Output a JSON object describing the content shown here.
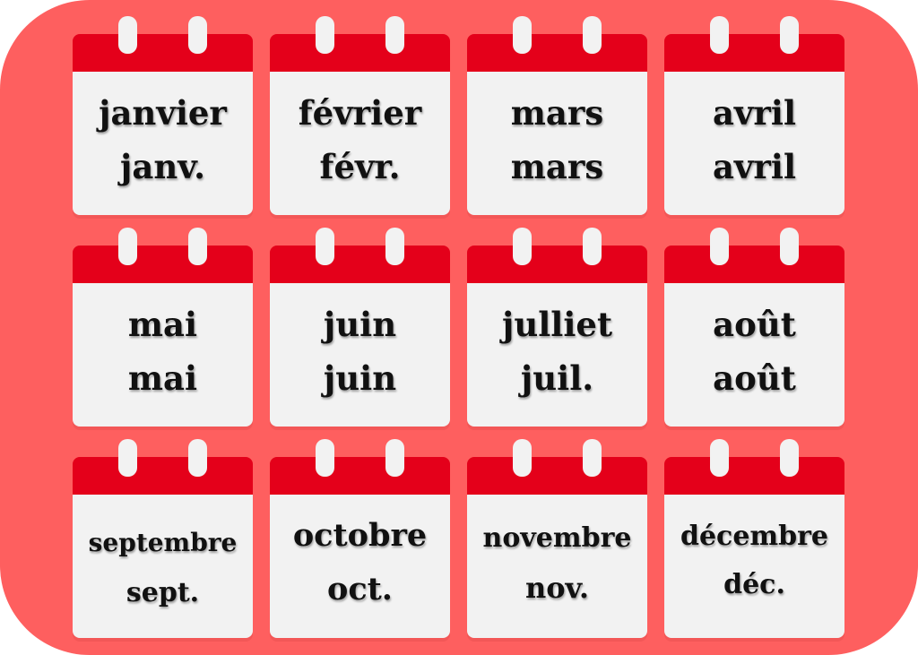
{
  "months": [
    {
      "name": "janvier",
      "abbr": "janv."
    },
    {
      "name": "février",
      "abbr": "févr."
    },
    {
      "name": "mars",
      "abbr": "mars"
    },
    {
      "name": "avril",
      "abbr": "avril"
    },
    {
      "name": "mai",
      "abbr": "mai"
    },
    {
      "name": "juin",
      "abbr": "juin"
    },
    {
      "name": "julliet",
      "abbr": "juil."
    },
    {
      "name": "août",
      "abbr": "août"
    },
    {
      "name": "septembre",
      "abbr": "sept."
    },
    {
      "name": "octobre",
      "abbr": "oct."
    },
    {
      "name": "novembre",
      "abbr": "nov."
    },
    {
      "name": "décembre",
      "abbr": "déc."
    }
  ],
  "colors": {
    "background": "#fe5f5f",
    "calendar_header": "#e4001a",
    "calendar_page": "#f2f2f2",
    "text": "#111111"
  }
}
